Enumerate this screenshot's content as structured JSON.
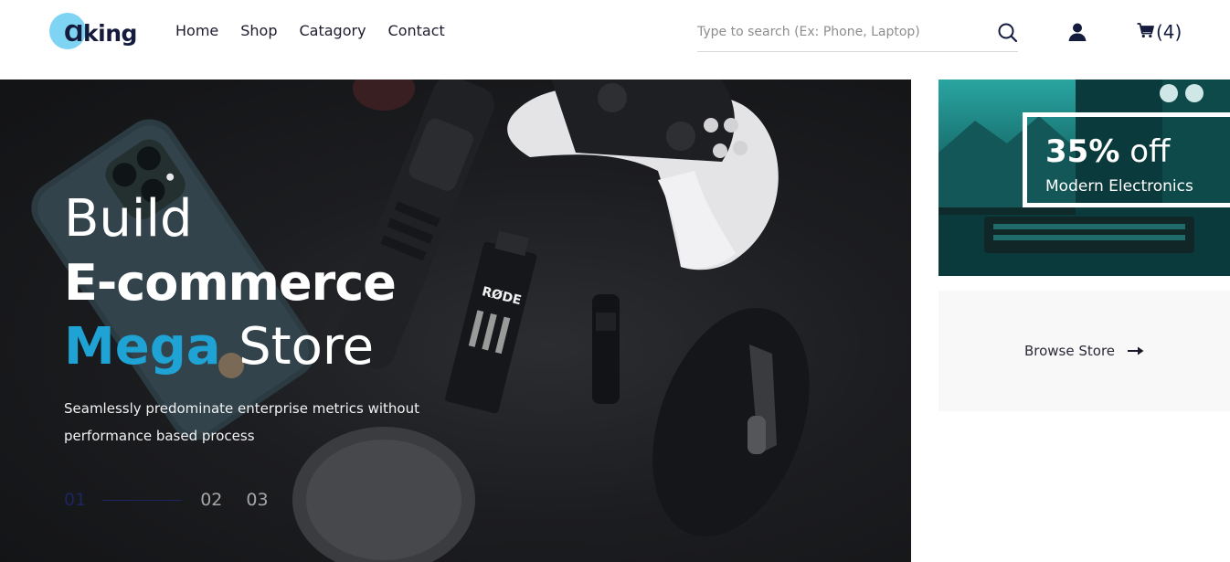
{
  "brand": {
    "logo_text": "Ɑking"
  },
  "nav": {
    "items": [
      "Home",
      "Shop",
      "Catagory",
      "Contact"
    ]
  },
  "search": {
    "placeholder": "Type to search (Ex: Phone, Laptop)"
  },
  "cart": {
    "count": "(4)"
  },
  "hero": {
    "line1": "Build",
    "line2": "E-commerce",
    "line3_highlight": "Mega",
    "line3_rest": "Store",
    "description": "Seamlessly predominate enterprise metrics without performance based process",
    "slides": [
      "01",
      "02",
      "03"
    ],
    "mic_label": "RØDE"
  },
  "promo": {
    "percent": "35%",
    "off": "off",
    "subtitle": "Modern Electronics"
  },
  "browse": {
    "label": "Browse Store"
  },
  "colors": {
    "accent": "#1ea3d4",
    "navy": "#141b3d",
    "logo_circle": "#7fd4f4"
  },
  "icons": [
    "search-icon",
    "user-icon",
    "cart-icon",
    "arrow-right-icon"
  ]
}
